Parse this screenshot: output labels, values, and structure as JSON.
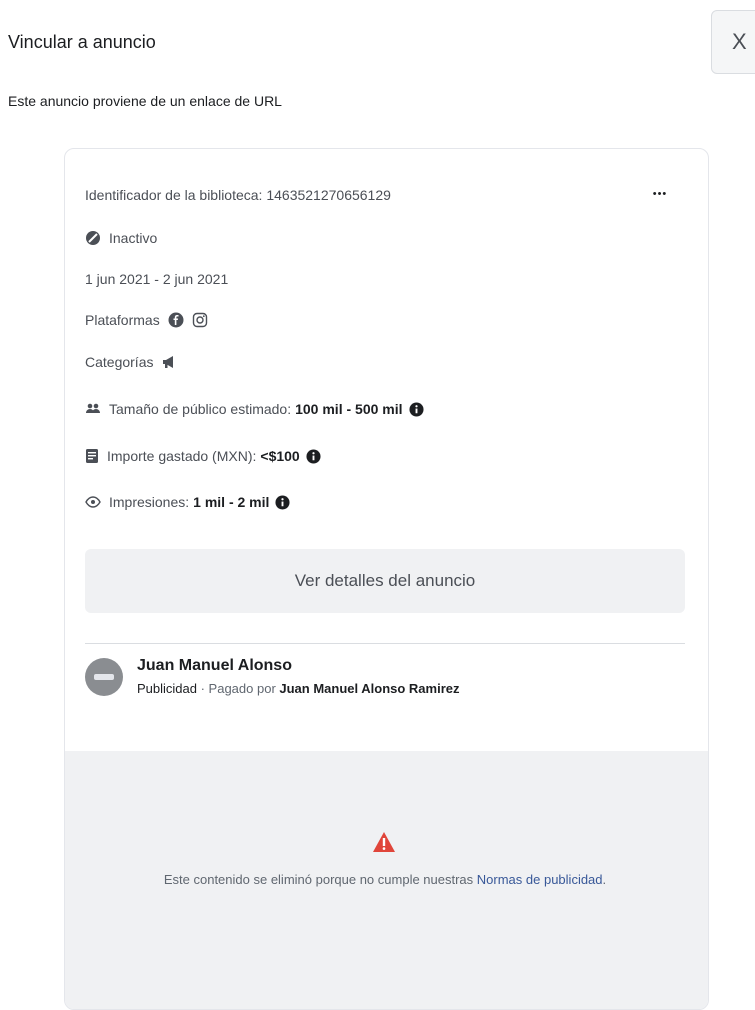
{
  "header": {
    "title": "Vincular a anuncio",
    "close_label": "X"
  },
  "subtitle": "Este anuncio proviene de un enlace de URL",
  "ad": {
    "library_id": "Identificador de la biblioteca: 1463521270656129",
    "more_label": "•••",
    "status": "Inactivo",
    "date_range": "1 jun 2021 - 2 jun 2021",
    "platforms_label": "Plataformas",
    "categories_label": "Categorías",
    "audience_label": "Tamaño de público estimado:",
    "audience_value": "100 mil - 500 mil",
    "spend_label": "Importe gastado (MXN):",
    "spend_value": "<$100",
    "impressions_label": "Impresiones:",
    "impressions_value": "1 mil - 2 mil",
    "details_button": "Ver detalles del anuncio"
  },
  "advertiser": {
    "name": "Juan Manuel Alonso",
    "type": "Publicidad",
    "paid_by_prefix": " · Pagado por ",
    "paid_by": "Juan Manuel Alonso Ramirez"
  },
  "removed": {
    "message": "Este contenido se eliminó porque no cumple nuestras ",
    "link_text": "Normas de publicidad",
    "link_suffix": "."
  },
  "colors": {
    "link": "#385898",
    "warning": "#e0453a",
    "background_gray": "#f0f1f3"
  }
}
